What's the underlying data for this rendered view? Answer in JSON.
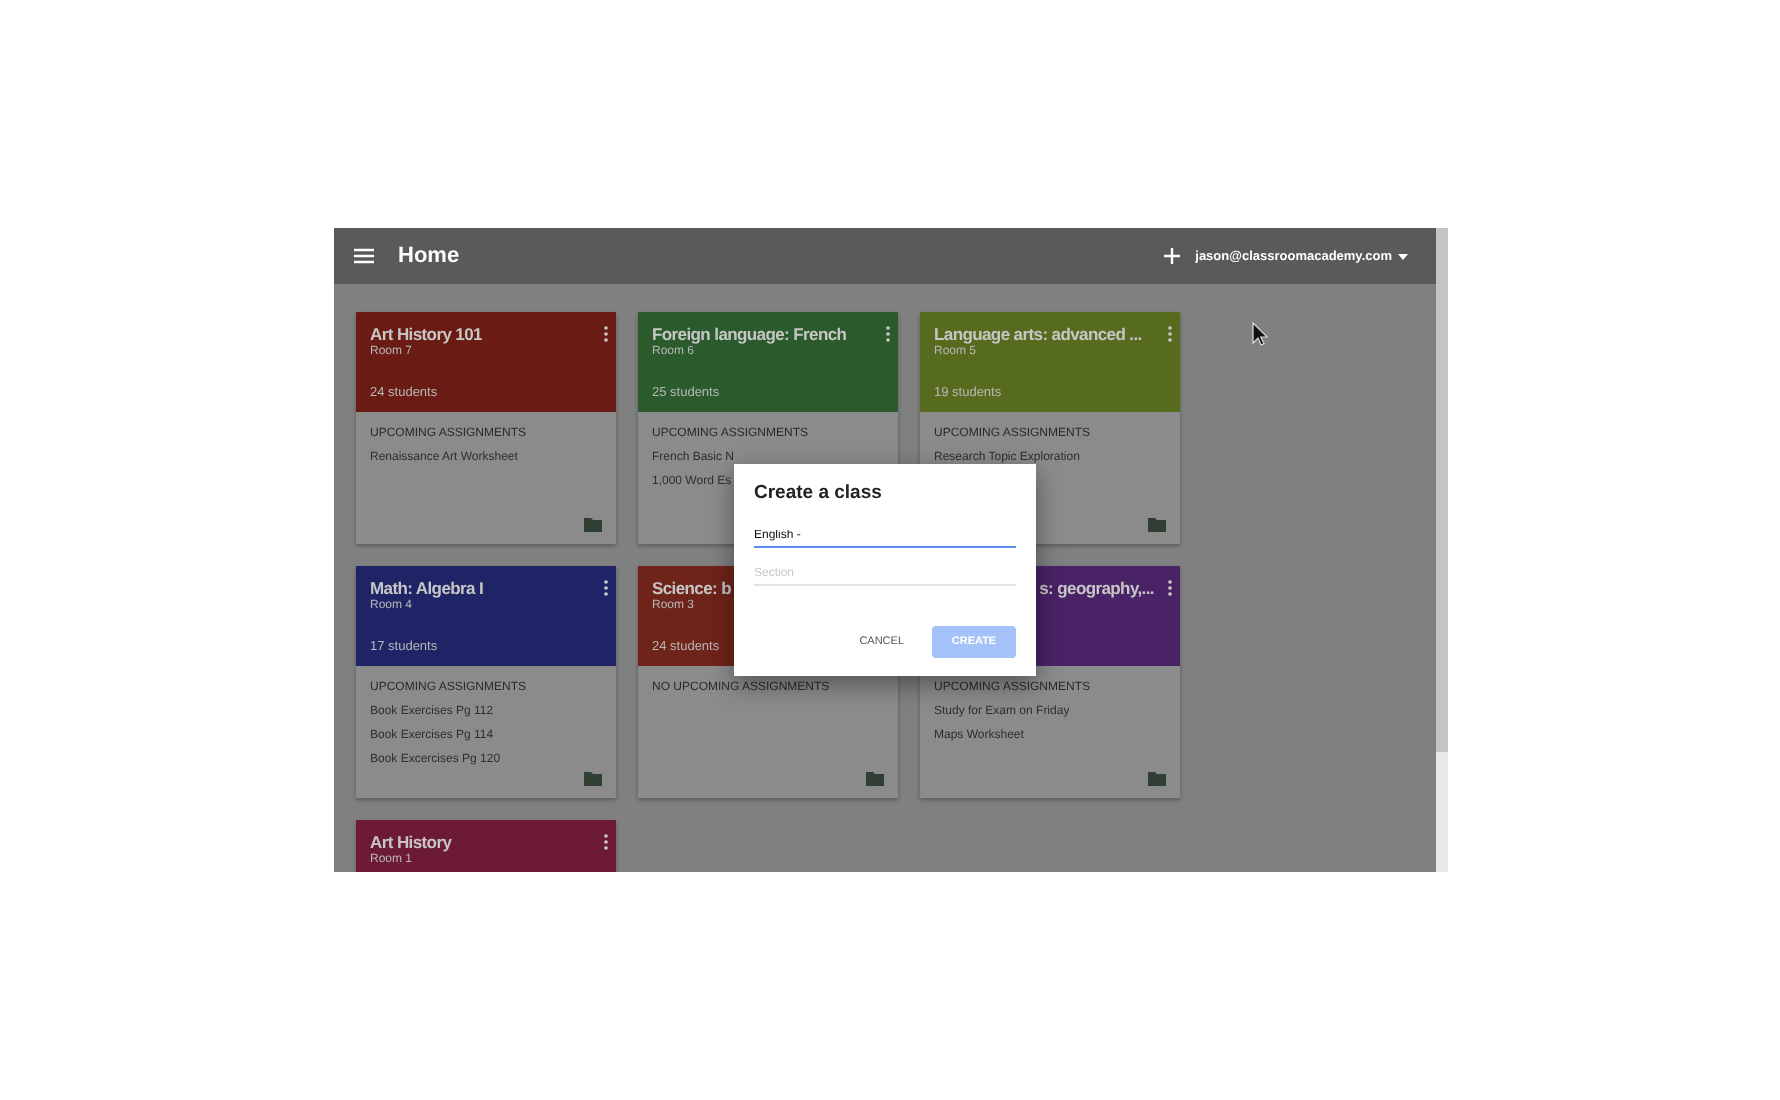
{
  "toolbar": {
    "title": "Home",
    "account": "jason@classroomacademy.com"
  },
  "cards": [
    {
      "title": "Art History 101",
      "room": "Room 7",
      "students": "24 students",
      "color": "#6a1c14",
      "heading": "UPCOMING ASSIGNMENTS",
      "items": [
        "Renaissance Art Worksheet"
      ]
    },
    {
      "title": "Foreign language: French",
      "room": "Room 6",
      "students": "25 students",
      "color": "#2b5a2c",
      "heading": "UPCOMING ASSIGNMENTS",
      "items": [
        "French Basic N",
        "1,000 Word Es"
      ]
    },
    {
      "title": "Language arts: advanced ...",
      "room": "Room 5",
      "students": "19 students",
      "color": "#566b1e",
      "heading": "UPCOMING ASSIGNMENTS",
      "items": [
        "Research Topic Exploration"
      ]
    },
    {
      "title": "Math: Algebra I",
      "room": "Room 4",
      "students": "17 students",
      "color": "#1f2466",
      "heading": "UPCOMING ASSIGNMENTS",
      "items": [
        "Book Exercises Pg 112",
        "Book Exercises Pg 114",
        "Book Excercises Pg 120"
      ]
    },
    {
      "title": "Science: b",
      "room": "Room 3",
      "students": "24 students",
      "color": "#6e2419",
      "heading": "NO UPCOMING ASSIGNMENTS"
    },
    {
      "title": "s: geography,...",
      "kind": "covered_left",
      "color": "#4a2366",
      "heading": "UPCOMING ASSIGNMENTS",
      "items": [
        "Study for Exam on Friday",
        "Maps Worksheet"
      ]
    },
    {
      "title": "Art History",
      "room": "Room 1",
      "color": "#6d1a36"
    }
  ],
  "dialog": {
    "title": "Create a class",
    "name_field": {
      "value": "English -"
    },
    "section_field": {
      "placeholder": "Section"
    },
    "buttons": [
      {
        "label": "CANCEL",
        "kind": "flat",
        "disabled": false
      },
      {
        "label": "CREATE",
        "kind": "raised",
        "disabled": true
      }
    ]
  }
}
